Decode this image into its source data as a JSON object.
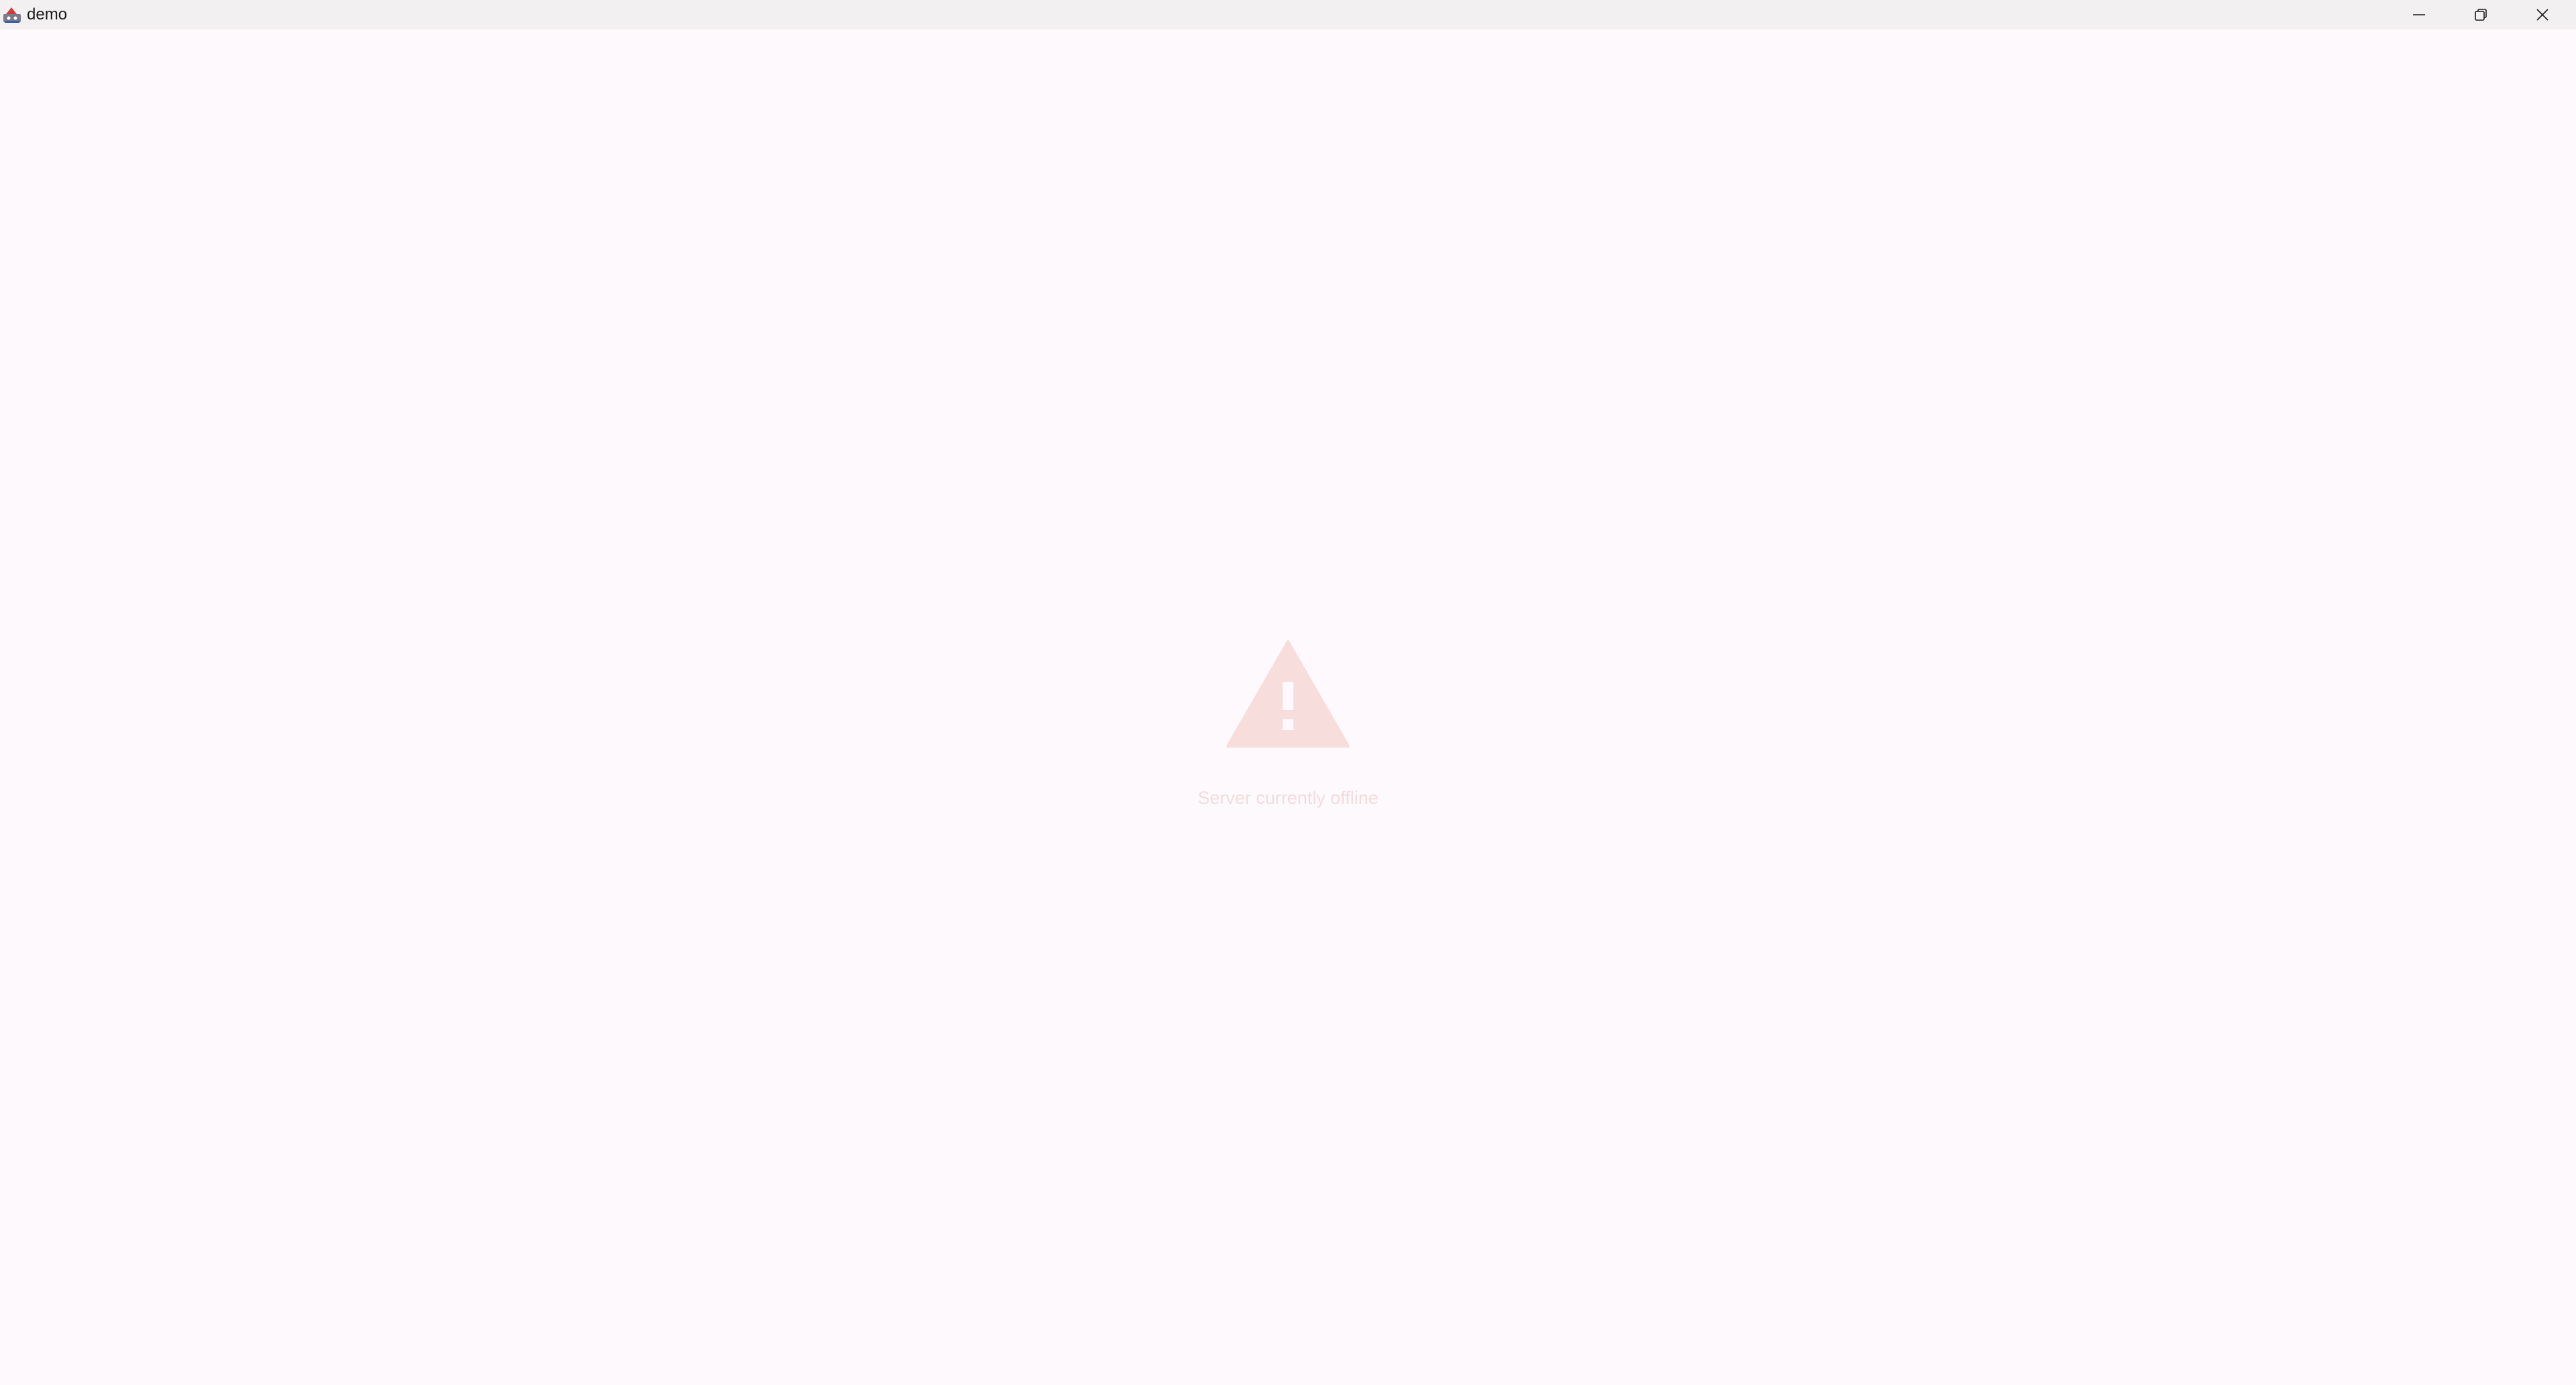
{
  "window": {
    "title": "demo",
    "app_icon": "java-duke-icon",
    "controls": {
      "minimize": "minimize-icon",
      "restore": "restore-icon",
      "close": "close-icon"
    }
  },
  "main": {
    "status_icon": "warning-triangle-icon",
    "status_message": "Server currently offline"
  },
  "colors": {
    "background": "#fef9fc",
    "titlebar": "#f2f0f1",
    "warning": "#f7dedd",
    "message": "#f3dcde"
  }
}
